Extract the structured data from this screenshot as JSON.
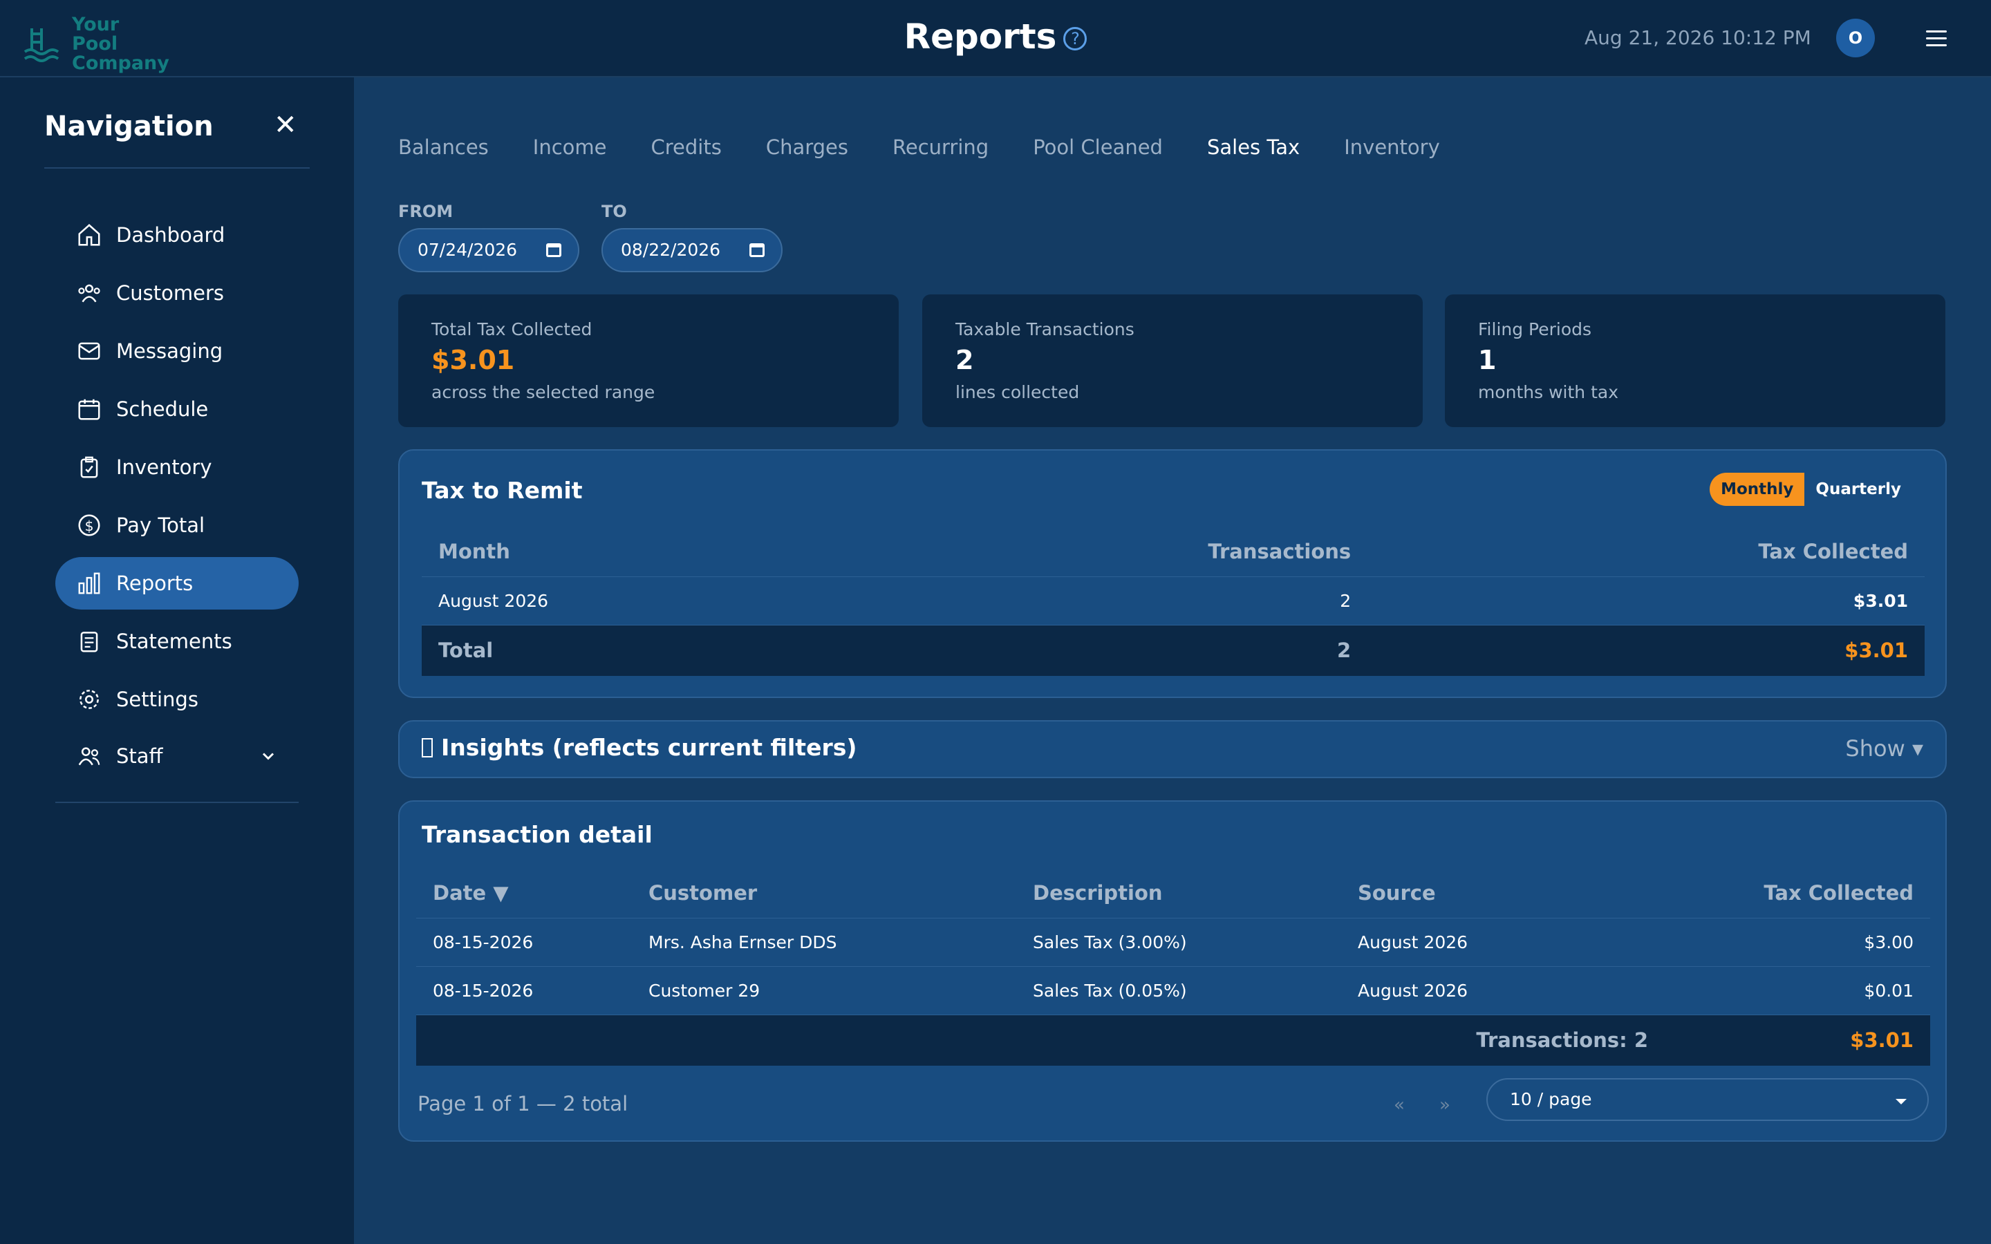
{
  "brand": {
    "name": "Your Pool Company",
    "accent": "#f7931e",
    "primary": "#2563a6"
  },
  "header": {
    "title": "Reports",
    "datetime": "Aug 21, 2026 10:12 PM",
    "avatar_initial": "O"
  },
  "sidebar": {
    "title": "Navigation",
    "items": [
      {
        "label": "Dashboard",
        "icon": "home-icon"
      },
      {
        "label": "Customers",
        "icon": "users-icon"
      },
      {
        "label": "Messaging",
        "icon": "mail-icon"
      },
      {
        "label": "Schedule",
        "icon": "calendar-icon"
      },
      {
        "label": "Inventory",
        "icon": "clipboard-check-icon"
      },
      {
        "label": "Pay Total",
        "icon": "dollar-circle-icon"
      },
      {
        "label": "Reports",
        "icon": "bar-chart-icon",
        "active": true
      },
      {
        "label": "Statements",
        "icon": "document-icon"
      },
      {
        "label": "Settings",
        "icon": "gear-icon"
      },
      {
        "label": "Staff",
        "icon": "user-group-icon"
      }
    ]
  },
  "tabs": [
    "Balances",
    "Income",
    "Credits",
    "Charges",
    "Recurring",
    "Pool Cleaned",
    "Sales Tax",
    "Inventory"
  ],
  "active_tab": "Sales Tax",
  "filters": {
    "from_label": "FROM",
    "from_value": "07/24/2026",
    "to_label": "TO",
    "to_value": "08/22/2026"
  },
  "stats": [
    {
      "label": "Total Tax Collected",
      "value": "$3.01",
      "sub": "across the selected range"
    },
    {
      "label": "Taxable Transactions",
      "value": "2",
      "sub": "lines collected"
    },
    {
      "label": "Filing Periods",
      "value": "1",
      "sub": "months with tax"
    }
  ],
  "remit": {
    "title": "Tax to Remit",
    "toggle": {
      "monthly": "Monthly",
      "quarterly": "Quarterly",
      "selected": "Monthly"
    },
    "headers": {
      "month": "Month",
      "transactions": "Transactions",
      "tax": "Tax Collected"
    },
    "rows": [
      {
        "month": "August 2026",
        "transactions": "2",
        "tax": "$3.01"
      }
    ],
    "total": {
      "label": "Total",
      "transactions": "2",
      "tax": "$3.01"
    }
  },
  "insights": {
    "title": "Insights (reflects current filters)",
    "toggle": "Show ▾"
  },
  "detail": {
    "title": "Transaction detail",
    "headers": {
      "date": "Date ▼",
      "customer": "Customer",
      "description": "Description",
      "source": "Source",
      "tax": "Tax Collected"
    },
    "rows": [
      {
        "date": "08-15-2026",
        "customer": "Mrs. Asha Ernser DDS",
        "description": "Sales Tax (3.00%)",
        "source": "August 2026",
        "tax": "$3.00"
      },
      {
        "date": "08-15-2026",
        "customer": "Customer 29",
        "description": "Sales Tax (0.05%)",
        "source": "August 2026",
        "tax": "$0.01"
      }
    ],
    "footer": {
      "count": "Transactions: 2",
      "total": "$3.01"
    },
    "pager": {
      "text": "Page 1 of 1 — 2 total",
      "prev": "«",
      "next": "»",
      "page_size": "10 / page"
    }
  }
}
